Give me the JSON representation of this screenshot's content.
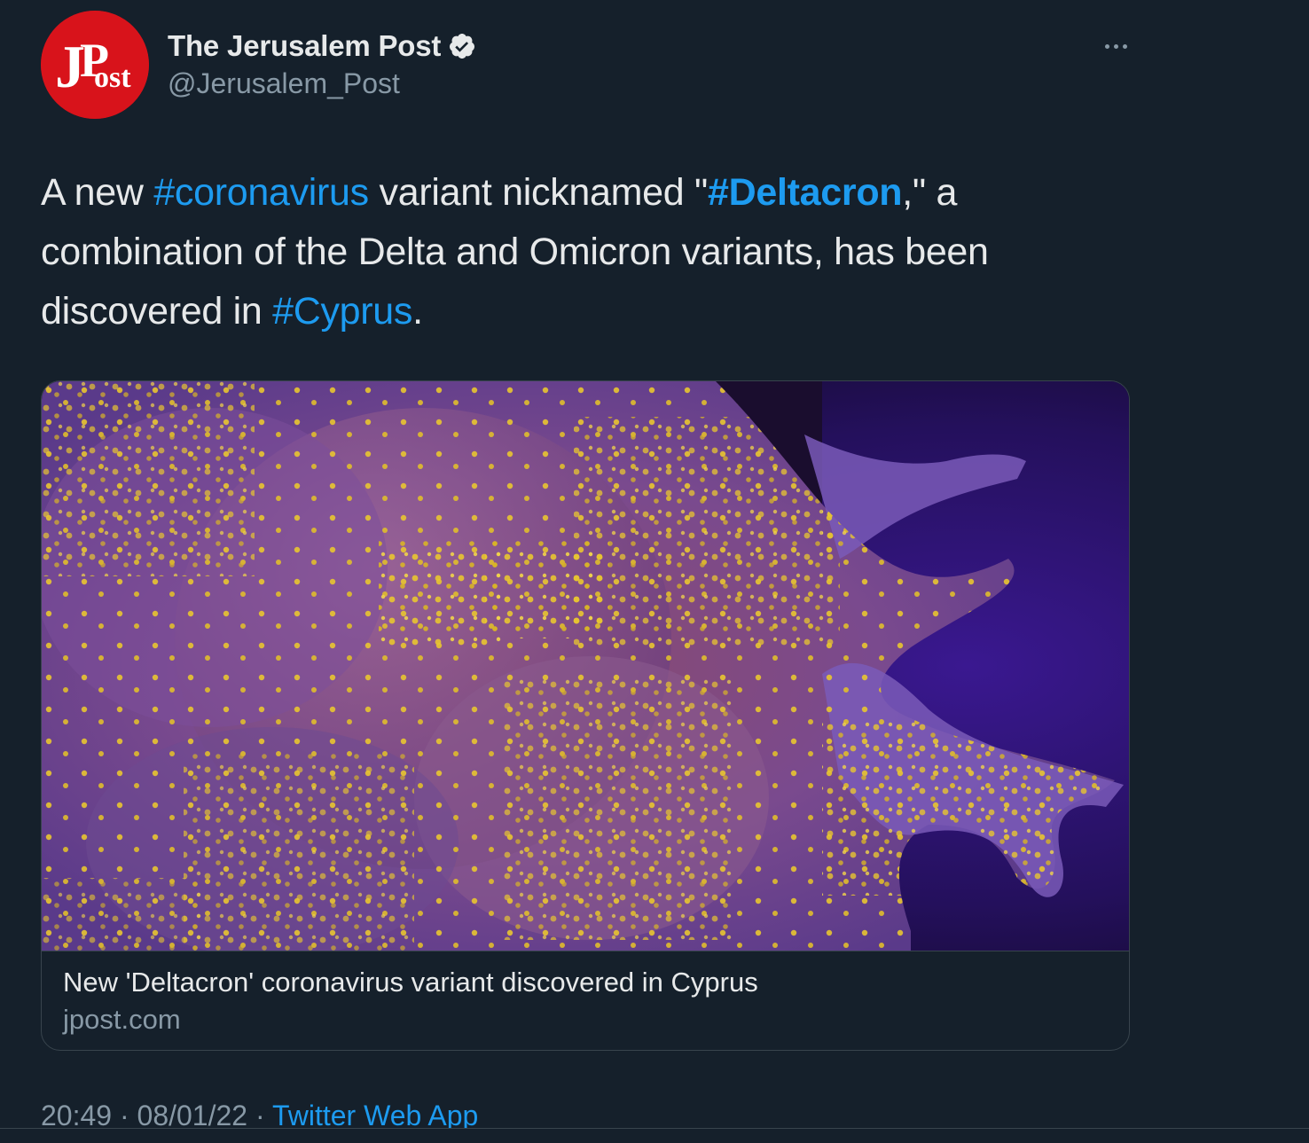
{
  "author": {
    "display_name": "The Jerusalem Post",
    "handle": "@Jerusalem_Post",
    "avatar_icon": "jpost-logo",
    "avatar_color": "#d8131b",
    "verified": true
  },
  "tweet": {
    "segments": [
      {
        "text": "A new ",
        "type": "text"
      },
      {
        "text": "#coronavirus",
        "type": "hashtag"
      },
      {
        "text": " variant nicknamed \"",
        "type": "text"
      },
      {
        "text": "#Deltacron",
        "type": "hashtag-bold"
      },
      {
        "text": ",\" a combination of the Delta and Omicron variants, has been discovered in ",
        "type": "text"
      },
      {
        "text": "#Cyprus",
        "type": "hashtag"
      },
      {
        "text": ".",
        "type": "text"
      }
    ]
  },
  "card": {
    "image_description_icon": "virus-micrograph-image",
    "title": "New 'Deltacron' coronavirus variant discovered in Cyprus",
    "domain": "jpost.com"
  },
  "meta": {
    "time": "20:49",
    "separator1": " · ",
    "date": "08/01/22",
    "separator2": " · ",
    "source": "Twitter Web App"
  },
  "colors": {
    "background": "#15202b",
    "accent": "#1d9bf0",
    "text": "#e7e9ea",
    "secondary": "#8899a6",
    "border": "#38444d"
  }
}
